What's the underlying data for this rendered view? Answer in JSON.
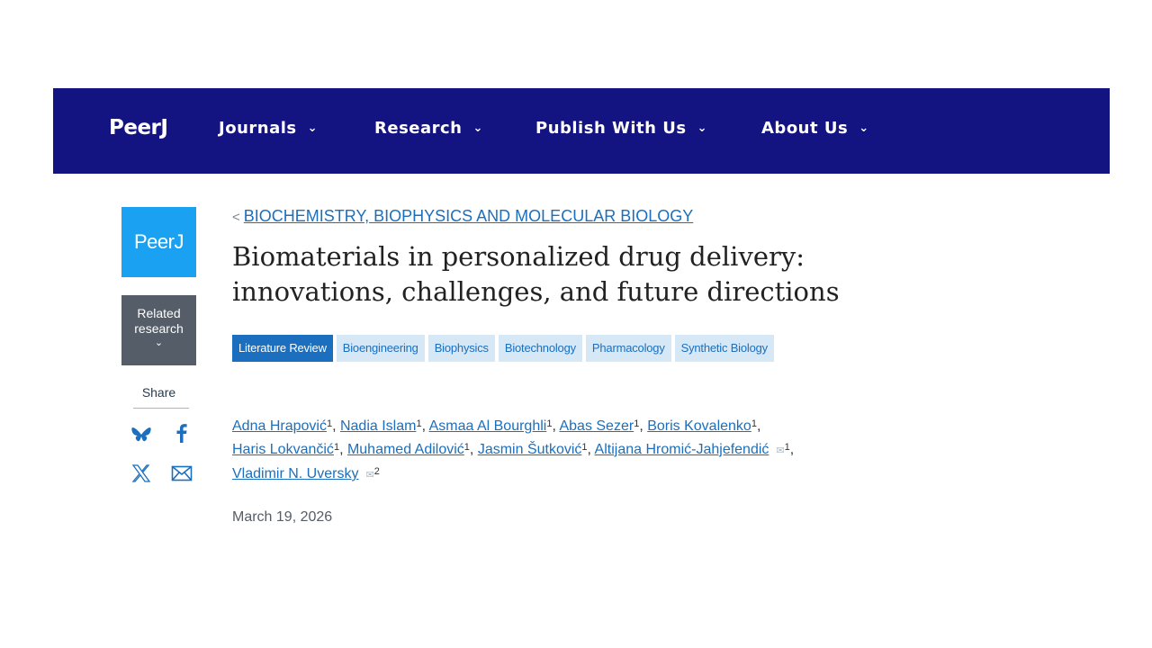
{
  "nav": {
    "logo": "PeerJ",
    "items": [
      {
        "label": "Journals"
      },
      {
        "label": "Research"
      },
      {
        "label": "Publish With Us"
      },
      {
        "label": "About Us"
      }
    ]
  },
  "sidebar": {
    "logo": "PeerJ",
    "related_line1": "Related",
    "related_line2": "research",
    "share_label": "Share",
    "share_icons": [
      "bluesky-icon",
      "facebook-icon",
      "x-icon",
      "email-icon"
    ]
  },
  "article": {
    "breadcrumb": "BIOCHEMISTRY, BIOPHYSICS AND MOLECULAR BIOLOGY",
    "title": "Biomaterials in personalized drug delivery: innovations, challenges, and future directions",
    "tags": [
      "Literature Review",
      "Bioengineering",
      "Biophysics",
      "Biotechnology",
      "Pharmacology",
      "Synthetic Biology"
    ],
    "authors": [
      {
        "name": "Adna Hrapović",
        "aff": "1"
      },
      {
        "name": "Nadia Islam",
        "aff": "1"
      },
      {
        "name": "Asmaa Al Bourghli",
        "aff": "1"
      },
      {
        "name": "Abas Sezer",
        "aff": "1"
      },
      {
        "name": "Boris Kovalenko",
        "aff": "1"
      },
      {
        "name": "Haris Lokvančić",
        "aff": "1"
      },
      {
        "name": "Muhamed Adilović",
        "aff": "1"
      },
      {
        "name": "Jasmin Šutković",
        "aff": "1"
      },
      {
        "name": "Altijana Hromić-Jahjefendić",
        "aff": "1"
      },
      {
        "name": "Vladimir N. Uversky",
        "aff": "2"
      }
    ],
    "date": "March 19, 2026"
  },
  "colors": {
    "navbar": "#131381",
    "logo_box": "#1ba1f2",
    "related_box": "#545d68",
    "link": "#1b6fbe",
    "tag_bg": "#d6e8f5"
  }
}
